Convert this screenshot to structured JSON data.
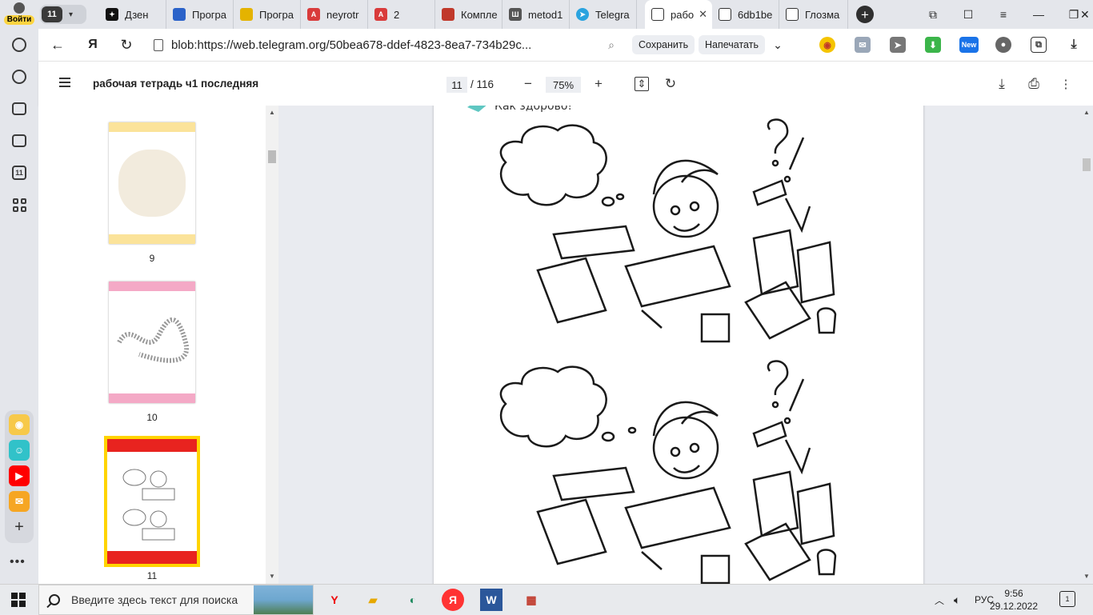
{
  "sidebar": {
    "login_label": "Войти",
    "tabs_count": "11"
  },
  "tabs": {
    "counter": "11",
    "items": [
      {
        "label": "Дзен"
      },
      {
        "label": "Програ"
      },
      {
        "label": "Програ"
      },
      {
        "label": "neyrotr"
      },
      {
        "label": "2"
      },
      {
        "label": "Компле"
      },
      {
        "label": "metod1"
      },
      {
        "label": "Telegra"
      },
      {
        "label": "рабо"
      },
      {
        "label": "6db1be"
      },
      {
        "label": "Глозма"
      }
    ]
  },
  "address_bar": {
    "url": "blob:https://web.telegram.org/50bea678-ddef-4823-8ea7-734b29c...",
    "save_label": "Сохранить",
    "print_label": "Напечатать",
    "ext_new_label": "New"
  },
  "pdf_toolbar": {
    "title": "рабочая тетрадь ч1 последняя",
    "current_page": "11",
    "total_pages": "/ 116",
    "zoom": "75%"
  },
  "thumbnails": [
    {
      "number": "9",
      "band_color": "#fbe39a"
    },
    {
      "number": "10",
      "band_color": "#f4a9c6"
    },
    {
      "number": "11",
      "band_color": "#e8231f"
    }
  ],
  "page": {
    "caption": "Как здорово!"
  },
  "taskbar": {
    "search_placeholder": "Введите здесь текст для поиска",
    "lang": "РУС",
    "time": "9:56",
    "date": "29.12.2022",
    "notif_count": "1"
  }
}
